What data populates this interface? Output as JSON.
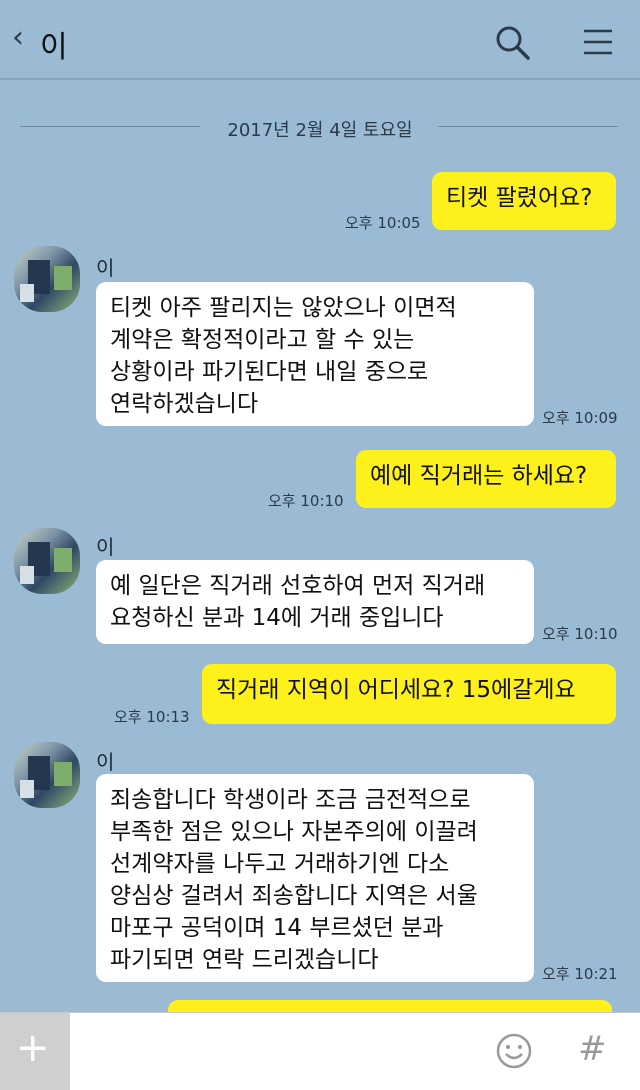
{
  "header": {
    "back_glyph": "‹",
    "title": "이",
    "search_icon": "search-icon",
    "menu_icon": "menu-icon"
  },
  "date_divider": "2017년 2월 4일 토요일",
  "messages": [
    {
      "side": "out",
      "text": "티켓 팔렸어요?",
      "time": "오후 10:05"
    },
    {
      "side": "in",
      "sender": "이",
      "text": "티켓 아주 팔리지는 않았으나 이면적\n계약은 확정적이라고 할 수 있는\n상황이라 파기된다면 내일 중으로\n연락하겠습니다",
      "time": "오후 10:09"
    },
    {
      "side": "out",
      "text": "예예 직거래는 하세요?",
      "time": "오후 10:10"
    },
    {
      "side": "in",
      "sender": "이",
      "text": "예 일단은 직거래 선호하여 먼저 직거래\n요청하신 분과 14에 거래 중입니다",
      "time": "오후 10:10"
    },
    {
      "side": "out",
      "text": "직거래 지역이 어디세요? 15에갈게요",
      "time": "오후 10:13"
    },
    {
      "side": "in",
      "sender": "이",
      "text": "죄송합니다 학생이라 조금 금전적으로\n부족한 점은 있으나 자본주의에 이끌려\n선계약자를 나두고 거래하기엔 다소\n양심상 걸려서 죄송합니다 지역은 서울\n마포구 공덕이며 14 부르셨던 분과\n파기되면 연락 드리겠습니다",
      "time": "오후 10:21"
    }
  ],
  "input_bar": {
    "plus_label": "+",
    "emoji_icon": "emoji-icon",
    "hash_label": "#"
  },
  "colors": {
    "background": "#9bbbd4",
    "outgoing_bubble": "#fef01b",
    "incoming_bubble": "#ffffff"
  }
}
